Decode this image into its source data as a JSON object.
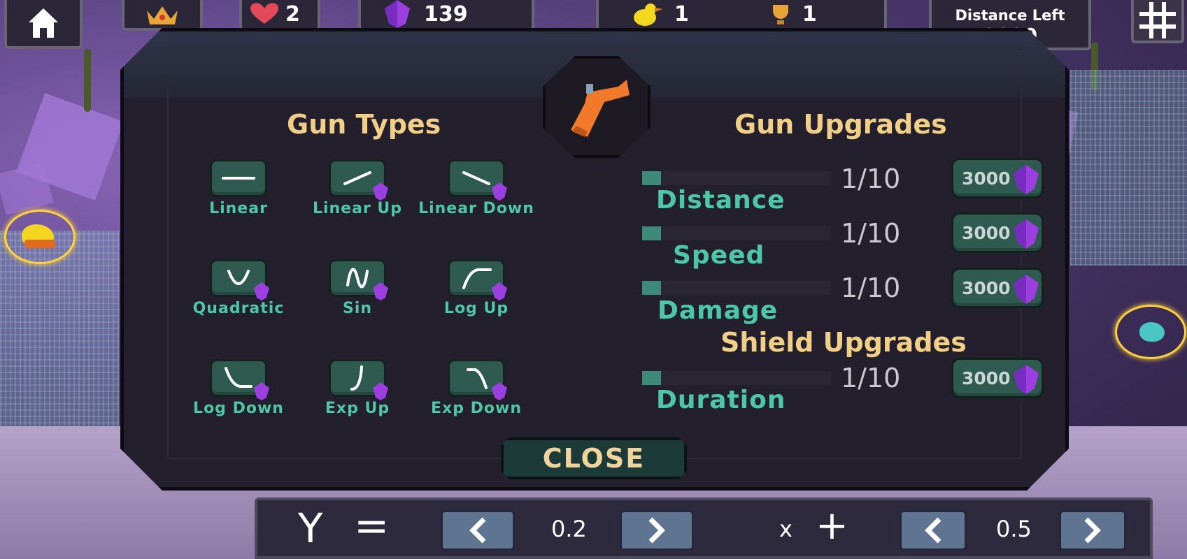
{
  "hud": {
    "lives": "2",
    "gems": "139",
    "birds": "1",
    "trophies": "1",
    "distance_label": "Distance Left",
    "distance_value": "3000"
  },
  "gun_types": {
    "title": "Gun Types",
    "items": [
      {
        "label": "Linear",
        "locked": false
      },
      {
        "label": "Linear Up",
        "locked": true
      },
      {
        "label": "Linear Down",
        "locked": true
      },
      {
        "label": "Quadratic",
        "locked": true
      },
      {
        "label": "Sin",
        "locked": true
      },
      {
        "label": "Log Up",
        "locked": true
      },
      {
        "label": "Log Down",
        "locked": true
      },
      {
        "label": "Exp Up",
        "locked": true
      },
      {
        "label": "Exp Down",
        "locked": true
      }
    ]
  },
  "gun_upgrades": {
    "title": "Gun Upgrades",
    "items": [
      {
        "label": "Distance",
        "level": "1/10",
        "level_fraction": 0.1,
        "cost": "3000"
      },
      {
        "label": "Speed",
        "level": "1/10",
        "level_fraction": 0.1,
        "cost": "3000"
      },
      {
        "label": "Damage",
        "level": "1/10",
        "level_fraction": 0.1,
        "cost": "3000"
      }
    ]
  },
  "shield_upgrades": {
    "title": "Shield Upgrades",
    "items": [
      {
        "label": "Duration",
        "level": "1/10",
        "level_fraction": 0.1,
        "cost": "3000"
      }
    ]
  },
  "close_label": "CLOSE",
  "equation": {
    "y_label": "Y",
    "equals": "=",
    "coefficient": "0.2",
    "x_label": "x",
    "plus": "+",
    "constant": "0.5"
  },
  "colors": {
    "accent_teal": "#4cc8a8",
    "title_gold": "#f2cf86",
    "gem_purple": "#9b3fe0",
    "button_green": "#2f5a50"
  },
  "icons": [
    "home-icon",
    "crown-icon",
    "heart-icon",
    "gem-icon",
    "duck-icon",
    "trophy-icon",
    "grid-icon",
    "gun-icon",
    "chevron-left-icon",
    "chevron-right-icon"
  ]
}
